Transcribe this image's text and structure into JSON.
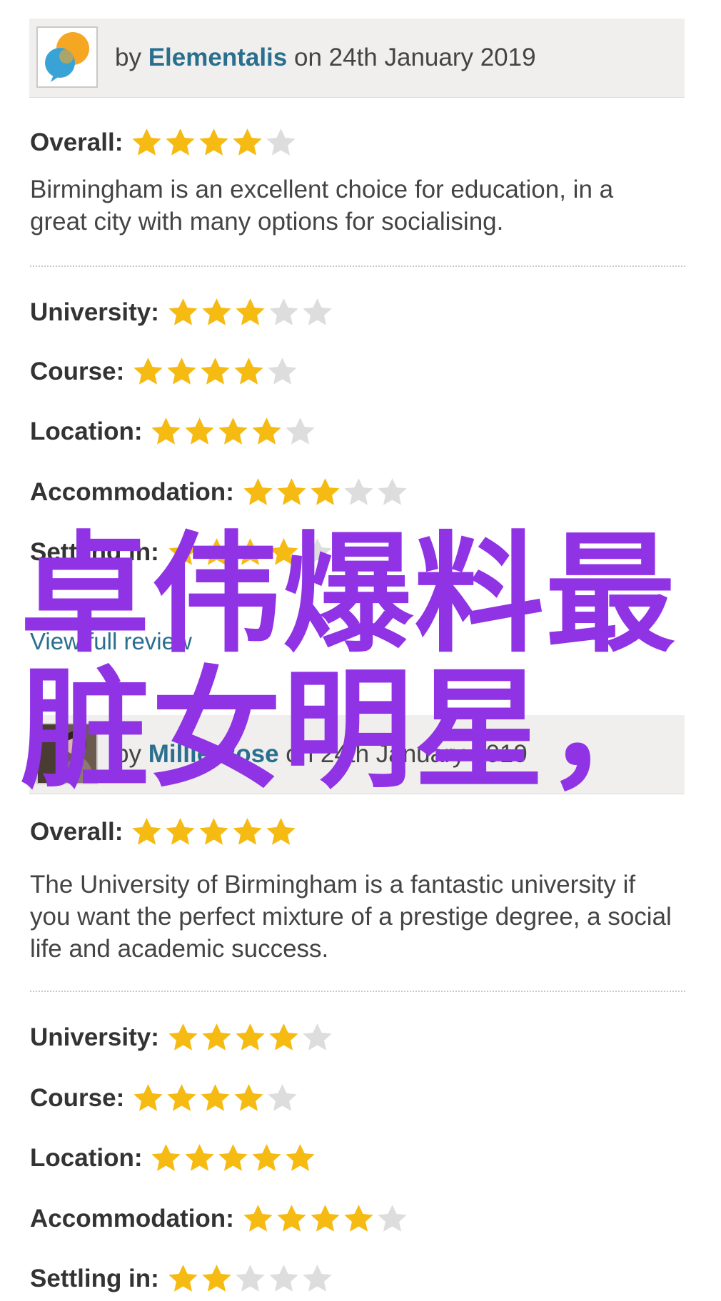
{
  "colors": {
    "star_filled": "#f6bb12",
    "star_empty": "#dddddd",
    "link": "#2a6f8e",
    "overlay": "#9033e5"
  },
  "reviews": [
    {
      "by_prefix": "by ",
      "author": "Elementalis",
      "date": " on 24th January 2019",
      "avatar_icon": "orange-blue-bubbles-avatar-icon",
      "overall_label": "Overall:",
      "overall_stars": 4,
      "text": "Birmingham is an excellent choice for education, in a great city with many options for socialising.",
      "ratings": [
        {
          "label": "University:",
          "stars": 3
        },
        {
          "label": "Course:",
          "stars": 4
        },
        {
          "label": "Location:",
          "stars": 4
        },
        {
          "label": "Accommodation:",
          "stars": 3
        },
        {
          "label": "Settling in:",
          "stars": 4
        }
      ],
      "view_full_review": "View full review"
    },
    {
      "by_prefix": "by ",
      "author": "Millie Rose",
      "date": " on 24th January 2019",
      "avatar_icon": "photo-avatar-icon",
      "overall_label": "Overall:",
      "overall_stars": 5,
      "text": "The University of Birmingham is a fantastic university if you want the perfect mixture of a prestige degree, a social life and academic success.",
      "ratings": [
        {
          "label": "University:",
          "stars": 4
        },
        {
          "label": "Course:",
          "stars": 4
        },
        {
          "label": "Location:",
          "stars": 5
        },
        {
          "label": "Accommodation:",
          "stars": 4
        },
        {
          "label": "Settling in:",
          "stars": 2
        }
      ]
    }
  ],
  "max_stars": 5,
  "overlay": {
    "line1": "卓伟爆料最",
    "line2": "脏女明星，"
  }
}
